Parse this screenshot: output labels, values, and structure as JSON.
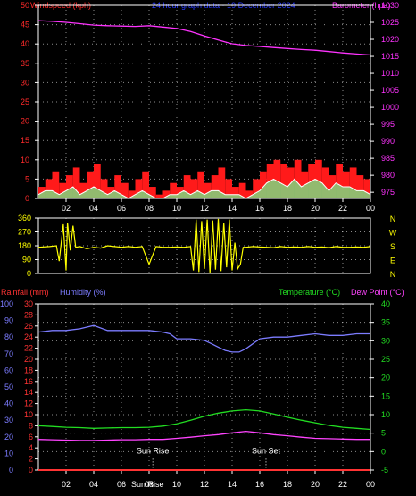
{
  "colors": {
    "background": "#000000",
    "axis": "#ffffff",
    "grid": "#ffffff",
    "wind_label": "#ff2a2a",
    "title": "#2a3cff",
    "barometer": "#ff33ff",
    "wind_bar": "#ff1a1a",
    "gust_fill": "#7fd77f",
    "avg_line": "#ffffff",
    "direction": "#ffff00",
    "rain_axis": "#ff3333",
    "humidity": "#7c7cff",
    "temperature": "#22dd22",
    "dewpoint": "#ff44ff",
    "sun": "#ffffff"
  },
  "chart_data": [
    {
      "id": "wind-baro",
      "type": "line",
      "title": "24 hour graph data - 19 December 2024",
      "ylabel_left": "Windspeed (kph)",
      "ylabel_right": "Barometer (hpa)",
      "x_ticks": [
        "02",
        "04",
        "06",
        "08",
        "10",
        "12",
        "14",
        "16",
        "18",
        "20",
        "22",
        "00"
      ],
      "y_left_ticks": [
        0,
        5,
        10,
        15,
        20,
        25,
        30,
        35,
        40,
        45,
        50
      ],
      "ylim_left": [
        0,
        50
      ],
      "y_right_ticks": [
        975,
        980,
        985,
        990,
        995,
        1000,
        1005,
        1010,
        1015,
        1020,
        1025,
        1030
      ],
      "ylim_right": [
        973.2,
        1030
      ],
      "grid": true,
      "series": [
        {
          "name": "Barometer (hpa)",
          "axis": "right",
          "x": [
            0,
            1,
            2,
            3,
            4,
            5,
            6,
            7,
            8,
            9,
            10,
            11,
            12,
            13,
            14,
            15,
            16,
            17,
            18,
            19,
            20,
            21,
            22,
            23,
            24
          ],
          "values": [
            1025.5,
            1025.3,
            1025,
            1024.6,
            1024.2,
            1024,
            1023.9,
            1023.8,
            1024,
            1023.6,
            1023.2,
            1022.3,
            1021,
            1019.8,
            1018.7,
            1018.2,
            1017.9,
            1017.6,
            1017.3,
            1017,
            1016.8,
            1016.4,
            1016,
            1015.7,
            1015.4
          ]
        },
        {
          "name": "Wind gust",
          "axis": "left",
          "x": [
            0,
            0.5,
            1,
            1.5,
            2,
            2.5,
            3,
            3.5,
            4,
            4.5,
            5,
            5.5,
            6,
            6.5,
            7,
            7.5,
            8,
            8.5,
            9,
            9.5,
            10,
            10.5,
            11,
            11.5,
            12,
            12.5,
            13,
            13.5,
            14,
            14.5,
            15,
            15.5,
            16,
            16.5,
            17,
            17.5,
            18,
            18.5,
            19,
            19.5,
            20,
            20.5,
            21,
            21.5,
            22,
            22.5,
            23,
            23.5,
            24
          ],
          "values": [
            3,
            5,
            7,
            4,
            6,
            8,
            4,
            7,
            9,
            5,
            3,
            6,
            4,
            2,
            5,
            7,
            3,
            1,
            2,
            4,
            3,
            6,
            5,
            7,
            4,
            6,
            8,
            5,
            3,
            4,
            2,
            5,
            7,
            9,
            10,
            9,
            8,
            10,
            7,
            9,
            10,
            8,
            6,
            9,
            7,
            8,
            6,
            5,
            4
          ]
        },
        {
          "name": "Wind speed",
          "axis": "left",
          "x": [
            0,
            0.5,
            1,
            1.5,
            2,
            2.5,
            3,
            3.5,
            4,
            4.5,
            5,
            5.5,
            6,
            6.5,
            7,
            7.5,
            8,
            8.5,
            9,
            9.5,
            10,
            10.5,
            11,
            11.5,
            12,
            12.5,
            13,
            13.5,
            14,
            14.5,
            15,
            15.5,
            16,
            16.5,
            17,
            17.5,
            18,
            18.5,
            19,
            19.5,
            20,
            20.5,
            21,
            21.5,
            22,
            22.5,
            23,
            23.5,
            24
          ],
          "values": [
            1,
            2,
            2,
            1,
            2,
            3,
            1,
            2,
            3,
            2,
            1,
            2,
            1,
            0,
            1,
            2,
            1,
            0,
            0,
            1,
            1,
            2,
            1,
            2,
            1,
            2,
            2,
            1,
            1,
            1,
            0,
            1,
            2,
            4,
            5,
            4,
            3,
            5,
            3,
            4,
            5,
            4,
            2,
            4,
            3,
            3,
            2,
            2,
            1
          ]
        }
      ]
    },
    {
      "id": "direction",
      "type": "line",
      "x_ticks": [],
      "y_left_ticks": [
        0,
        90,
        180,
        270,
        360
      ],
      "ylim_left": [
        0,
        360
      ],
      "y_right_labels": [
        "N",
        "W",
        "S",
        "E",
        "N"
      ],
      "series": [
        {
          "name": "Wind direction",
          "x": [
            0,
            0.8,
            1.3,
            1.5,
            1.8,
            2,
            2.1,
            2.3,
            2.5,
            2.7,
            3,
            3.5,
            4,
            4.5,
            5,
            5.5,
            6,
            6.5,
            7,
            7.5,
            8,
            8.5,
            9,
            9.5,
            10,
            10.5,
            11,
            11.2,
            11.4,
            11.6,
            11.8,
            12,
            12.2,
            12.4,
            12.6,
            12.8,
            13,
            13.2,
            13.4,
            13.6,
            13.8,
            14,
            14.2,
            14.4,
            14.6,
            14.8,
            15,
            15.5,
            16,
            16.5,
            17,
            17.5,
            18,
            18.5,
            19,
            19.5,
            20,
            20.5,
            21,
            21.5,
            22,
            22.5,
            23,
            23.5,
            24
          ],
          "values": [
            170,
            175,
            180,
            80,
            320,
            20,
            330,
            150,
            310,
            170,
            175,
            160,
            170,
            165,
            180,
            175,
            170,
            175,
            170,
            175,
            60,
            175,
            170,
            170,
            172,
            170,
            175,
            20,
            350,
            10,
            340,
            30,
            350,
            5,
            345,
            25,
            355,
            15,
            330,
            40,
            350,
            20,
            200,
            30,
            60,
            170,
            170,
            175,
            172,
            170,
            168,
            175,
            170,
            172,
            170,
            175,
            170,
            172,
            168,
            175,
            170,
            170,
            172,
            170,
            175
          ]
        }
      ]
    },
    {
      "id": "temp-hum",
      "type": "line",
      "ylabel_left_1": "Rainfall (mm)",
      "ylabel_left_2": "Humidity (%)",
      "ylabel_right_1": "Temperature (°C)",
      "ylabel_right_2": "Dew Point (°C)",
      "x_ticks": [
        "02",
        "04",
        "06",
        "08",
        "10",
        "12",
        "14",
        "16",
        "18",
        "20",
        "22",
        "00"
      ],
      "humidity_ticks": [
        0,
        10,
        20,
        30,
        40,
        50,
        60,
        70,
        80,
        90,
        100
      ],
      "rain_ticks": [
        0,
        2,
        4,
        6,
        8,
        10,
        12,
        14,
        16,
        18,
        20,
        22,
        24,
        26,
        28,
        30
      ],
      "temp_ticks": [
        -5,
        0,
        5,
        10,
        15,
        20,
        25,
        30,
        35,
        40
      ],
      "ylim_temp": [
        -5,
        40
      ],
      "annotations": [
        {
          "x": 8.27,
          "label": "Sun Rise"
        },
        {
          "x": 16.45,
          "label": "Sun Set"
        }
      ],
      "bottom_label": "Sun Rise",
      "series": [
        {
          "name": "Humidity (%)",
          "axis": "humidity",
          "x": [
            0,
            1,
            2,
            3,
            3.5,
            4,
            5,
            6,
            7,
            8,
            9,
            9.5,
            10,
            11,
            12,
            12.5,
            13,
            13.5,
            14,
            14.5,
            15,
            16,
            17,
            18,
            19,
            20,
            21,
            22,
            23,
            24
          ],
          "values": [
            83,
            84,
            84,
            85,
            86,
            87,
            84,
            84,
            84,
            84,
            83,
            82,
            79,
            79,
            78,
            76,
            74,
            72,
            71,
            71,
            73,
            79,
            80,
            80,
            81,
            82,
            81,
            81,
            82,
            82
          ]
        },
        {
          "name": "Temperature (°C)",
          "axis": "temp",
          "x": [
            0,
            1,
            2,
            3,
            4,
            5,
            6,
            7,
            8,
            9,
            10,
            11,
            12,
            13,
            14,
            15,
            16,
            17,
            18,
            19,
            20,
            21,
            22,
            23,
            24
          ],
          "values": [
            7,
            6.8,
            6.6,
            6.5,
            6.3,
            6.4,
            6.5,
            6.5,
            6.6,
            6.9,
            7.5,
            8.5,
            9.6,
            10.4,
            11,
            11.3,
            11,
            10.2,
            9.3,
            8.5,
            7.8,
            7.1,
            6.6,
            6.3,
            6
          ]
        },
        {
          "name": "Dew Point (°C)",
          "axis": "temp",
          "x": [
            0,
            1,
            2,
            3,
            4,
            5,
            6,
            7,
            8,
            9,
            10,
            11,
            12,
            13,
            14,
            15,
            16,
            17,
            18,
            19,
            20,
            21,
            22,
            23,
            24
          ],
          "values": [
            3.3,
            3.2,
            3.1,
            3,
            3,
            3.1,
            3.2,
            3.2,
            3.3,
            3.3,
            3.6,
            3.9,
            4.3,
            4.6,
            5.1,
            5.5,
            5.1,
            4.6,
            4.3,
            3.9,
            3.6,
            3.5,
            3.4,
            3.3,
            3.3
          ]
        },
        {
          "name": "Rainfall (mm)",
          "axis": "rain",
          "x": [
            0,
            24
          ],
          "values": [
            0,
            0
          ]
        }
      ]
    }
  ]
}
